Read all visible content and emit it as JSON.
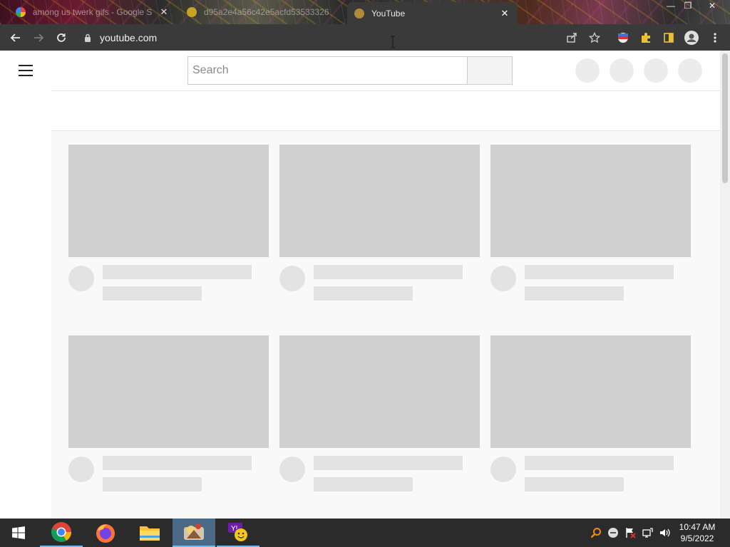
{
  "browser": {
    "tabs": [
      {
        "title": "among us twerk gifs - Google S",
        "favicon": "google-icon",
        "active": false
      },
      {
        "title": "d95a2e4a56c42e5acfd53533326",
        "favicon": "image-tab-icon",
        "active": false
      },
      {
        "title": "YouTube",
        "favicon": "youtube-loading-icon",
        "active": true
      }
    ],
    "tab_close_glyph": "✕",
    "window_controls": {
      "minimize": "—",
      "maximize": "❐",
      "close": "✕"
    },
    "url": "youtube.com"
  },
  "youtube": {
    "search_placeholder": "Search",
    "skeleton_rows": 2,
    "skeleton_columns": 3
  },
  "taskbar": {
    "apps": [
      "chrome-icon",
      "firefox-icon",
      "file-explorer-icon",
      "app-icon",
      "yahoo-messenger-icon"
    ],
    "clock": {
      "time": "10:47 AM",
      "date": "9/5/2022"
    }
  },
  "colors": {
    "toolbar": "#3a3a3a",
    "skeleton": "#d0d0d0",
    "taskbar": "#2b2b2b",
    "accent": "#76b9ed"
  }
}
